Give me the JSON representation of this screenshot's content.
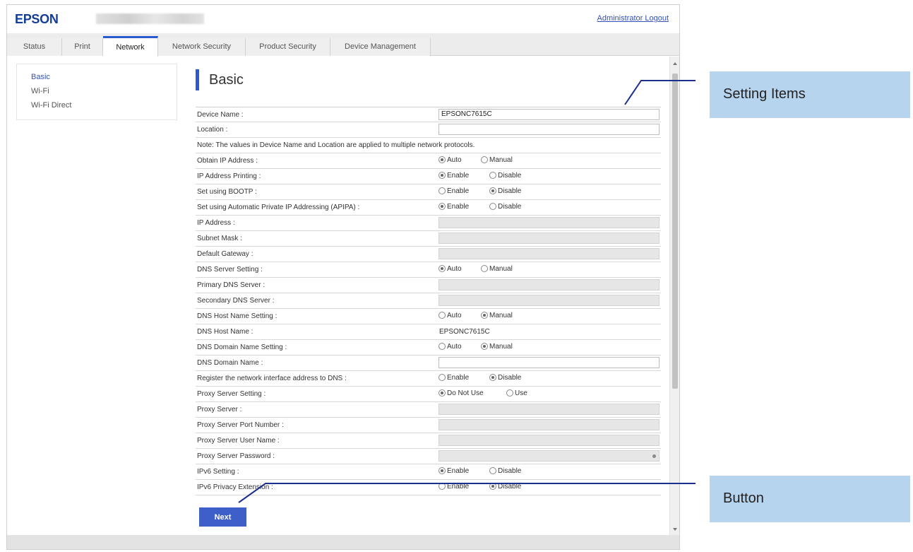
{
  "header": {
    "logo": "EPSON",
    "logout_link": "Administrator Logout"
  },
  "tabs": [
    {
      "label": "Status"
    },
    {
      "label": "Print"
    },
    {
      "label": "Network",
      "active": true
    },
    {
      "label": "Network Security"
    },
    {
      "label": "Product Security"
    },
    {
      "label": "Device Management"
    }
  ],
  "sidebar": {
    "items": [
      {
        "label": "Basic",
        "active": true
      },
      {
        "label": "Wi-Fi"
      },
      {
        "label": "Wi-Fi Direct"
      }
    ]
  },
  "page": {
    "heading": "Basic"
  },
  "form": {
    "device_name": {
      "label": "Device Name :",
      "value": "EPSONC7615C"
    },
    "location": {
      "label": "Location :",
      "value": ""
    },
    "note": "Note: The values in Device Name and Location are applied to multiple network protocols.",
    "obtain_ip": {
      "label": "Obtain IP Address :",
      "options": [
        "Auto",
        "Manual"
      ],
      "selected": "Auto"
    },
    "ip_printing": {
      "label": "IP Address Printing :",
      "options": [
        "Enable",
        "Disable"
      ],
      "selected": "Enable"
    },
    "bootp": {
      "label": "Set using BOOTP :",
      "options": [
        "Enable",
        "Disable"
      ],
      "selected": "Disable"
    },
    "apipa": {
      "label": "Set using Automatic Private IP Addressing (APIPA) :",
      "options": [
        "Enable",
        "Disable"
      ],
      "selected": "Enable"
    },
    "ip_address": {
      "label": "IP Address :"
    },
    "subnet_mask": {
      "label": "Subnet Mask :"
    },
    "default_gateway": {
      "label": "Default Gateway :"
    },
    "dns_server_setting": {
      "label": "DNS Server Setting :",
      "options": [
        "Auto",
        "Manual"
      ],
      "selected": "Auto"
    },
    "primary_dns": {
      "label": "Primary DNS Server :"
    },
    "secondary_dns": {
      "label": "Secondary DNS Server :"
    },
    "dns_host_name_setting": {
      "label": "DNS Host Name Setting :",
      "options": [
        "Auto",
        "Manual"
      ],
      "selected": "Manual"
    },
    "dns_host_name": {
      "label": "DNS Host Name :",
      "value": "EPSONC7615C"
    },
    "dns_domain_name_setting": {
      "label": "DNS Domain Name Setting :",
      "options": [
        "Auto",
        "Manual"
      ],
      "selected": "Manual"
    },
    "dns_domain_name": {
      "label": "DNS Domain Name :",
      "value": ""
    },
    "register_dns": {
      "label": "Register the network interface address to DNS :",
      "options": [
        "Enable",
        "Disable"
      ],
      "selected": "Disable"
    },
    "proxy_setting": {
      "label": "Proxy Server Setting :",
      "options": [
        "Do Not Use",
        "Use"
      ],
      "selected": "Do Not Use"
    },
    "proxy_server": {
      "label": "Proxy Server :"
    },
    "proxy_port": {
      "label": "Proxy Server Port Number :"
    },
    "proxy_user": {
      "label": "Proxy Server User Name :"
    },
    "proxy_password": {
      "label": "Proxy Server Password :"
    },
    "ipv6_setting": {
      "label": "IPv6 Setting :",
      "options": [
        "Enable",
        "Disable"
      ],
      "selected": "Enable"
    },
    "ipv6_privacy": {
      "label": "IPv6 Privacy Extension :",
      "options": [
        "Enable",
        "Disable"
      ],
      "selected": "Disable"
    }
  },
  "buttons": {
    "next": "Next"
  },
  "callouts": {
    "setting_items": "Setting Items",
    "button": "Button"
  },
  "colors": {
    "brand": "#123e9a",
    "accent": "#2a5ad0",
    "button": "#3e5fc8",
    "callout_bg": "#b7d4ee",
    "callout_line": "#1c2f8f"
  }
}
